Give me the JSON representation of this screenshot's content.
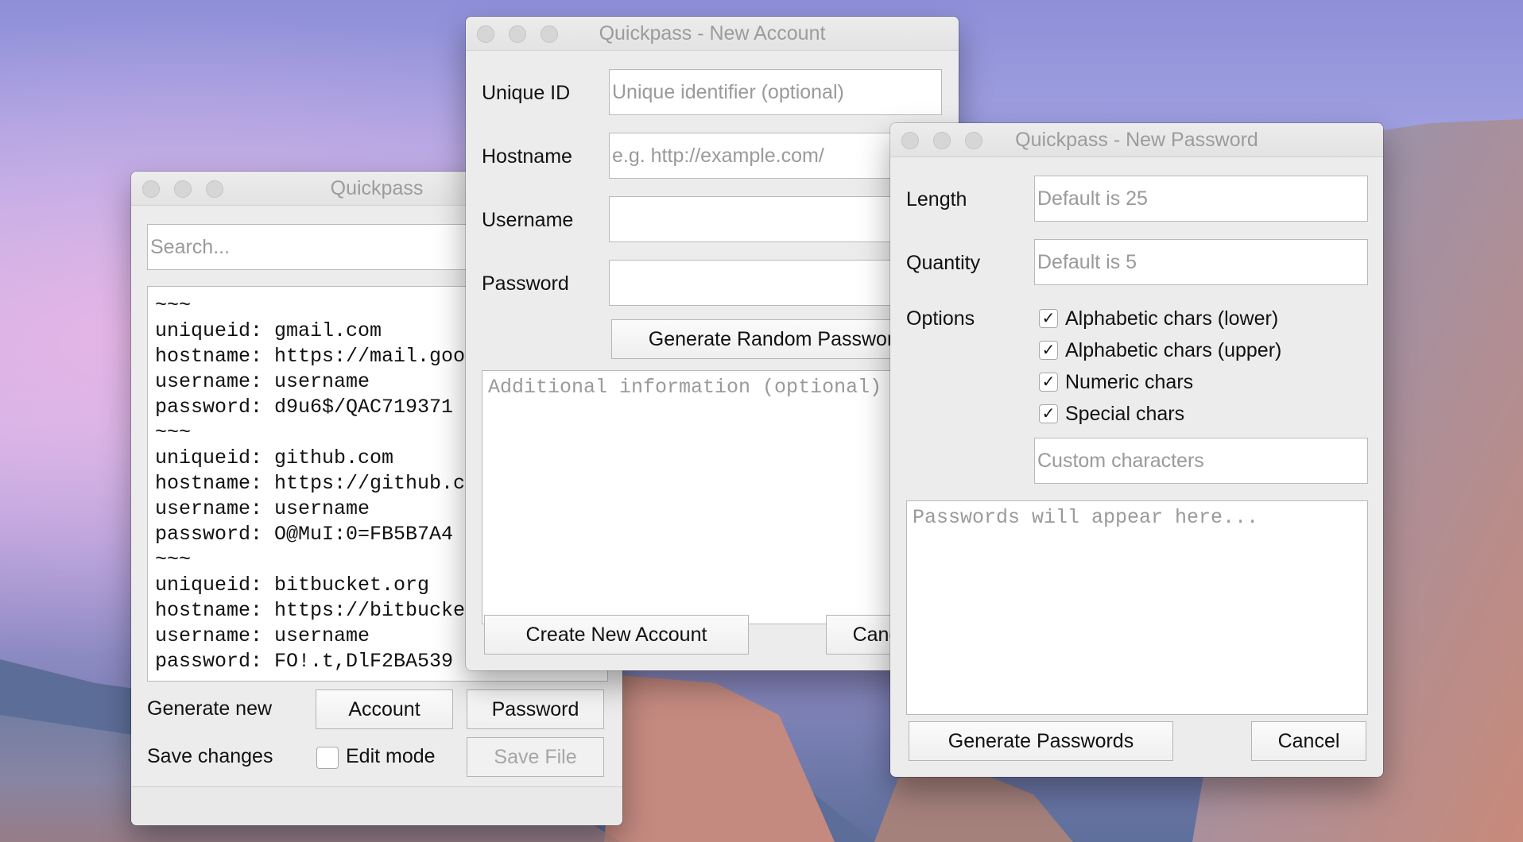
{
  "main_window": {
    "title": "Quickpass",
    "search_placeholder": "Search...",
    "log_lines": [
      "~~~",
      "uniqueid: gmail.com",
      "hostname: https://mail.google.com/",
      "username: username",
      "password: d9u6$/QAC719371",
      "~~~",
      "uniqueid: github.com",
      "hostname: https://github.com/",
      "username: username",
      "password: O@MuI:0=FB5B7A4",
      "~~~",
      "uniqueid: bitbucket.org",
      "hostname: https://bitbucket.org/",
      "username: username",
      "password: FO!.t,DlF2BA539"
    ],
    "generate_new_label": "Generate new",
    "account_button": "Account",
    "password_button": "Password",
    "save_changes_label": "Save changes",
    "edit_mode_label": "Edit mode",
    "edit_mode_checked": false,
    "save_file_button": "Save File"
  },
  "account_window": {
    "title": "Quickpass - New Account",
    "unique_id_label": "Unique ID",
    "unique_id_placeholder": "Unique identifier (optional)",
    "hostname_label": "Hostname",
    "hostname_placeholder": "e.g. http://example.com/",
    "username_label": "Username",
    "password_label": "Password",
    "generate_button": "Generate Random Password",
    "additional_placeholder": "Additional information (optional)",
    "create_button": "Create New Account",
    "cancel_button": "Cancel"
  },
  "password_window": {
    "title": "Quickpass - New Password",
    "length_label": "Length",
    "length_placeholder": "Default is 25",
    "quantity_label": "Quantity",
    "quantity_placeholder": "Default is 5",
    "options_label": "Options",
    "options": [
      {
        "label": "Alphabetic chars (lower)",
        "checked": true
      },
      {
        "label": "Alphabetic chars (upper)",
        "checked": true
      },
      {
        "label": "Numeric chars",
        "checked": true
      },
      {
        "label": "Special chars",
        "checked": true
      }
    ],
    "custom_placeholder": "Custom characters",
    "output_placeholder": "Passwords will appear here...",
    "generate_button": "Generate Passwords",
    "cancel_button": "Cancel"
  }
}
